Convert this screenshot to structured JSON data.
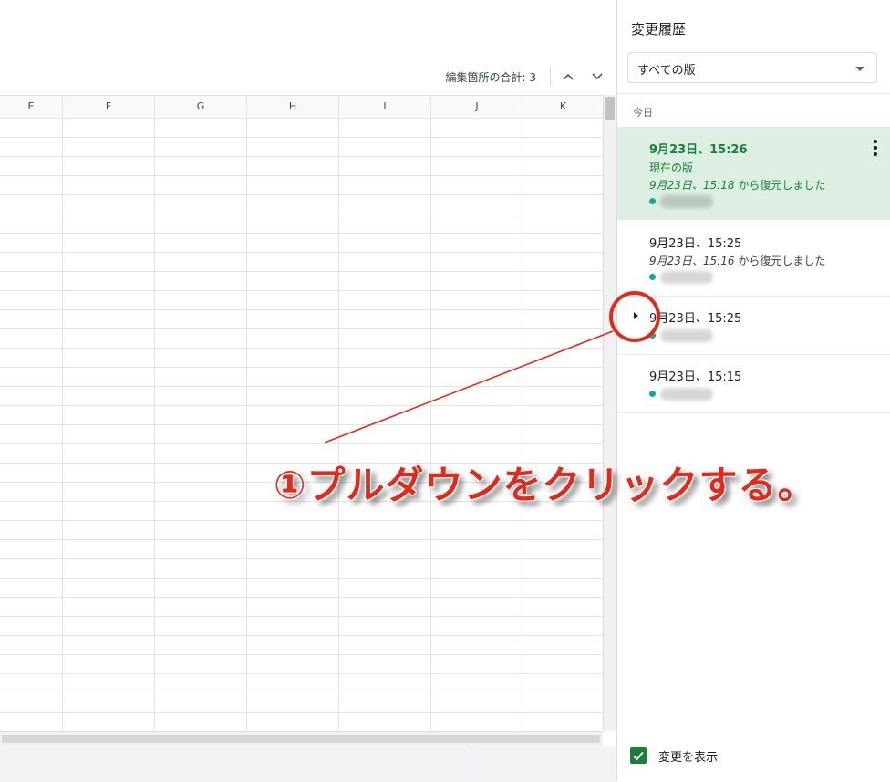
{
  "edits": {
    "count_label": "編集箇所の合計: 3"
  },
  "columns": [
    "E",
    "F",
    "G",
    "H",
    "I",
    "J",
    "K"
  ],
  "history_panel": {
    "title": "変更履歴",
    "filter": {
      "value": "すべての版"
    },
    "section_label": "今日",
    "versions": [
      {
        "date": "9月23日、15:26",
        "label": "現在の版",
        "restore_prefix": "9月23日、",
        "restore_time": "15:18",
        "restore_suffix": " から復元しました",
        "current": true
      },
      {
        "date": "9月23日、15:25",
        "restore_prefix": "9月23日、",
        "restore_time": "15:16",
        "restore_suffix": " から復元しました"
      },
      {
        "date": "9月23日、15:25",
        "expandable": true
      },
      {
        "date": "9月23日、15:15"
      }
    ],
    "footer": {
      "show_changes_label": "変更を表示",
      "checked": true
    }
  },
  "annotation": {
    "text": "①プルダウンをクリックする。",
    "color": "#e02a1c"
  },
  "colors": {
    "accent_green": "#188038",
    "current_bg": "#ddeee3",
    "user_dot": "#1aa890"
  }
}
